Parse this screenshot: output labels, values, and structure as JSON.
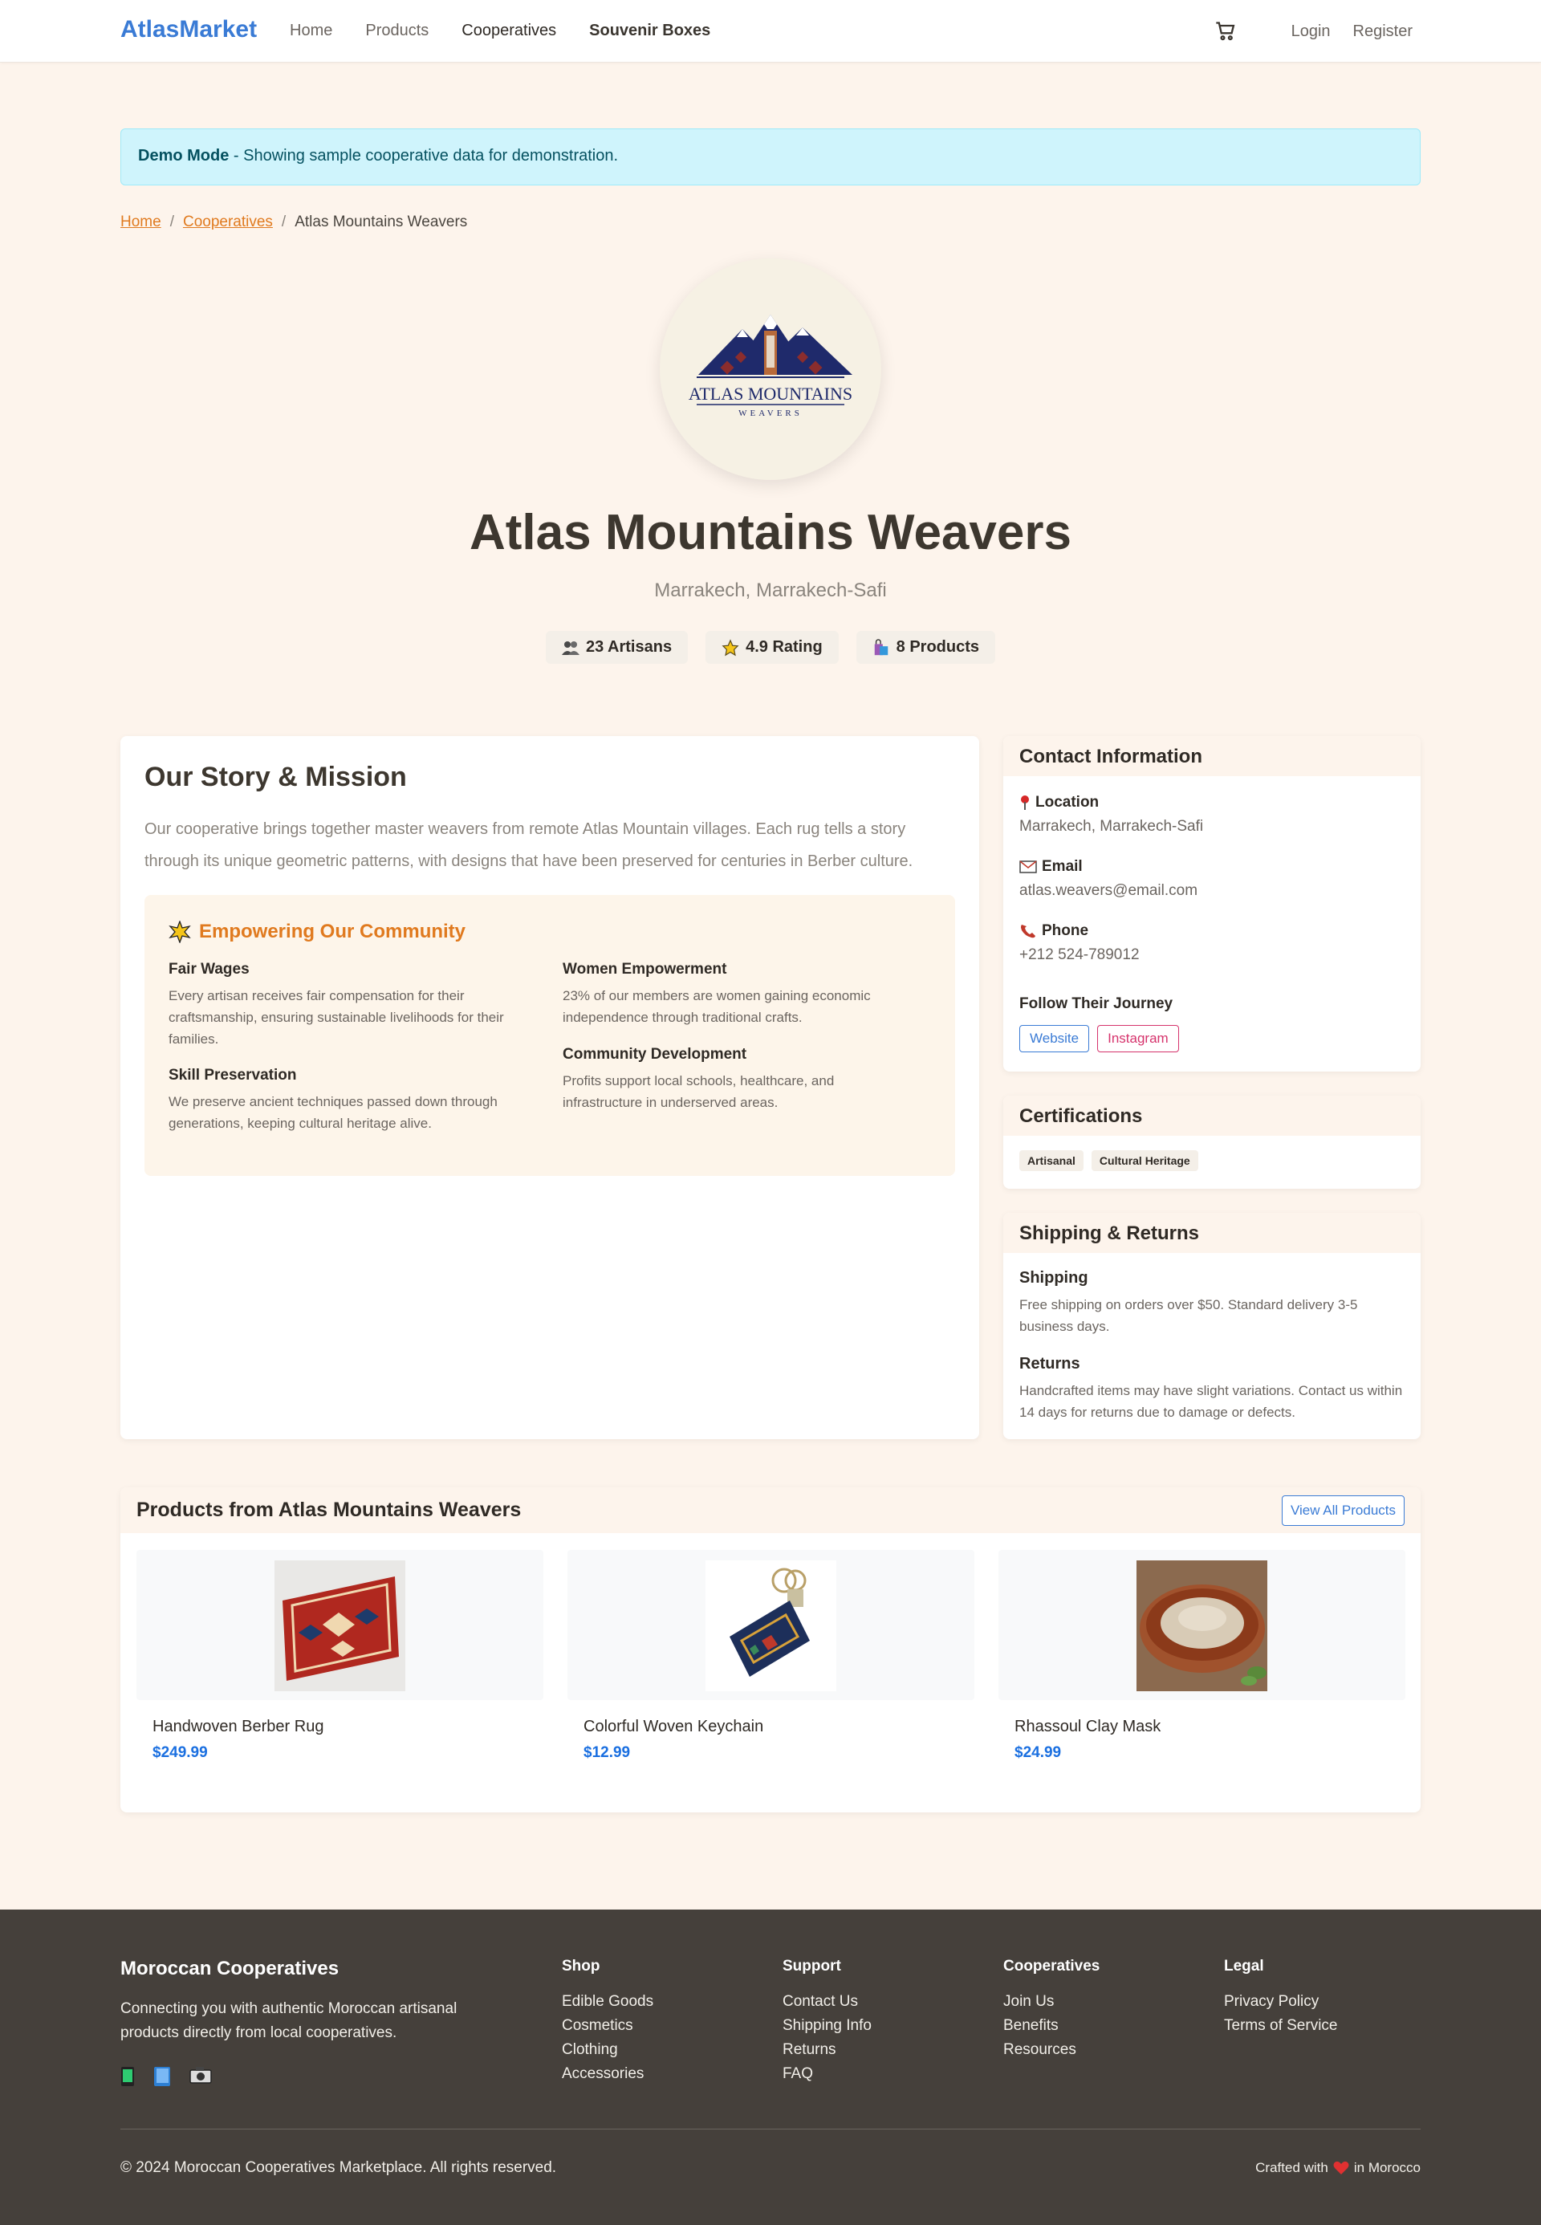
{
  "nav": {
    "brand": "AtlasMarket",
    "links": [
      "Home",
      "Products",
      "Cooperatives",
      "Souvenir Boxes"
    ],
    "login": "Login",
    "register": "Register",
    "cart_icon": "cart-icon"
  },
  "alert": {
    "strong": "Demo Mode",
    "text": " - Showing sample cooperative data for demonstration."
  },
  "breadcrumb": {
    "home": "Home",
    "cooperatives": "Cooperatives",
    "current": "Atlas Mountains Weavers",
    "separator": "/"
  },
  "coop": {
    "logo_text": "ATLAS MOUNTAINS",
    "logo_subtext": "WEAVERS",
    "name": "Atlas Mountains Weavers",
    "location": "Marrakech, Marrakech-Safi",
    "stats": [
      {
        "icon": "people-icon",
        "label": "23 Artisans"
      },
      {
        "icon": "star-icon",
        "label": "4.9 Rating"
      },
      {
        "icon": "shopping-bag-icon",
        "label": "8 Products"
      }
    ]
  },
  "story": {
    "title": "Our Story & Mission",
    "intro": "Our cooperative brings together master weavers from remote Atlas Mountain villages. Each rug tells a story through its unique geometric patterns, with designs that have been preserved for centuries in Berber culture.",
    "community_title": "Empowering Our Community",
    "items": [
      {
        "title": "Fair Wages",
        "text": "Every artisan receives fair compensation for their craftsmanship, ensuring sustainable livelihoods for their families."
      },
      {
        "title": "Women Empowerment",
        "text": "23% of our members are women gaining economic independence through traditional crafts."
      },
      {
        "title": "Skill Preservation",
        "text": "We preserve ancient techniques passed down through generations, keeping cultural heritage alive."
      },
      {
        "title": "Community Development",
        "text": "Profits support local schools, healthcare, and infrastructure in underserved areas."
      }
    ]
  },
  "contact": {
    "title": "Contact Information",
    "location_label": "Location",
    "location_value": "Marrakech, Marrakech-Safi",
    "email_label": "Email",
    "email_value": "atlas.weavers@email.com",
    "phone_label": "Phone",
    "phone_value": "+212 524-789012",
    "follow_title": "Follow Their Journey",
    "website": "Website",
    "instagram": "Instagram"
  },
  "certifications": {
    "title": "Certifications",
    "items": [
      "Artisanal",
      "Cultural Heritage"
    ]
  },
  "shipping": {
    "title": "Shipping & Returns",
    "shipping_title": "Shipping",
    "shipping_text": "Free shipping on orders over $50. Standard delivery 3-5 business days.",
    "returns_title": "Returns",
    "returns_text": "Handcrafted items may have slight variations. Contact us within 14 days for returns due to damage or defects."
  },
  "products": {
    "title": "Products from Atlas Mountains Weavers",
    "view_all": "View All Products",
    "items": [
      {
        "name": "Handwoven Berber Rug",
        "price": "$249.99"
      },
      {
        "name": "Colorful Woven Keychain",
        "price": "$12.99"
      },
      {
        "name": "Rhassoul Clay Mask",
        "price": "$24.99"
      }
    ]
  },
  "footer": {
    "brand": "Moroccan Cooperatives",
    "description": "Connecting you with authentic Moroccan artisanal products directly from local cooperatives.",
    "social_icons": [
      "phone-icon",
      "book-icon",
      "camera-icon"
    ],
    "columns": [
      {
        "title": "Shop",
        "links": [
          "Edible Goods",
          "Cosmetics",
          "Clothing",
          "Accessories"
        ]
      },
      {
        "title": "Support",
        "links": [
          "Contact Us",
          "Shipping Info",
          "Returns",
          "FAQ"
        ]
      },
      {
        "title": "Cooperatives",
        "links": [
          "Join Us",
          "Benefits",
          "Resources"
        ]
      },
      {
        "title": "Legal",
        "links": [
          "Privacy Policy",
          "Terms of Service"
        ]
      }
    ],
    "copyright": "© 2024 Moroccan Cooperatives Marketplace. All rights reserved.",
    "crafted_before": "Crafted with",
    "crafted_after": "in Morocco"
  },
  "colors": {
    "accent": "#3a7bd5",
    "orange": "#e07a1f",
    "price": "#1a6fe0",
    "footer_bg": "#45403b",
    "page_bg": "#fdf4ec"
  }
}
